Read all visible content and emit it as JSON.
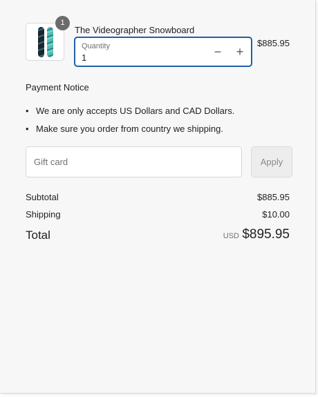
{
  "line_item": {
    "title": "The Videographer Snowboard",
    "image_icon": "snowboard-product-image",
    "quantity_badge": "1",
    "quantity_label": "Quantity",
    "quantity_value": "1",
    "decrease_symbol": "−",
    "increase_symbol": "+",
    "price": "$885.95"
  },
  "payment_notice": {
    "title": "Payment Notice",
    "bullet": "•",
    "items": [
      "We are only accepts US Dollars and CAD Dollars.",
      "Make sure you order from country we shipping."
    ]
  },
  "gift_card": {
    "placeholder": "Gift card",
    "apply_label": "Apply"
  },
  "summary": {
    "subtotal_label": "Subtotal",
    "subtotal_value": "$885.95",
    "shipping_label": "Shipping",
    "shipping_value": "$10.00",
    "total_label": "Total",
    "currency": "USD",
    "total_value": "$895.95"
  },
  "colors": {
    "focus_border": "#1f5fa6",
    "panel_background": "#f7f7f7",
    "badge": "#6b6b6b"
  }
}
